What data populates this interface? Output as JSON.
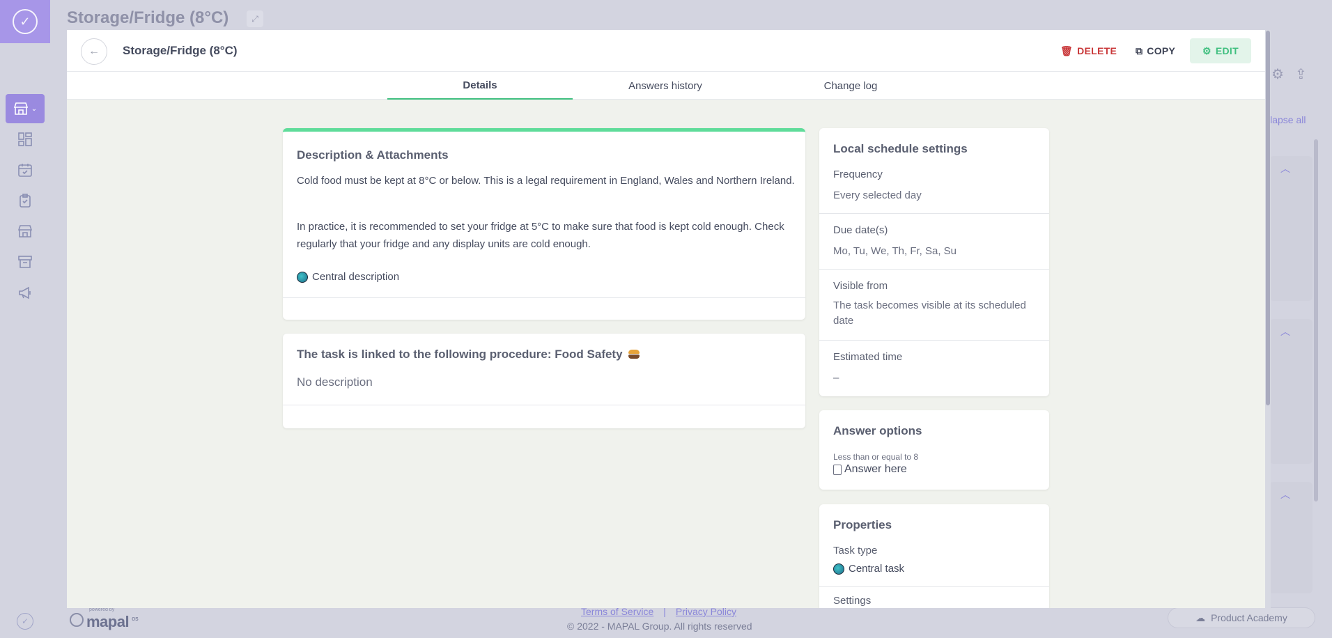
{
  "background": {
    "page_title": "Storage/Fridge (8°C)",
    "collapse_label": "llapse all"
  },
  "modal": {
    "title": "Storage/Fridge (8°C)",
    "actions": {
      "delete": "DELETE",
      "copy": "COPY",
      "edit": "EDIT"
    },
    "tabs": [
      {
        "label": "Details",
        "active": true
      },
      {
        "label": "Answers history",
        "active": false
      },
      {
        "label": "Change log",
        "active": false
      }
    ]
  },
  "description_card": {
    "heading": "Description & Attachments",
    "paragraph1": "Cold food must be kept at 8°C or below. This is a legal requirement in England, Wales and Northern Ireland.",
    "paragraph2": "In practice, it is recommended to set your fridge at 5°C to make sure that food is kept cold enough. Check regularly that your fridge and any display units are cold enough.",
    "central_label": "Central description"
  },
  "procedure_card": {
    "heading": "The task is linked to the following procedure: Food Safety",
    "no_description": "No description"
  },
  "schedule_card": {
    "heading": "Local schedule settings",
    "frequency_label": "Frequency",
    "frequency_value": "Every selected day",
    "due_label": "Due date(s)",
    "due_value": "Mo, Tu, We, Th, Fr, Sa, Su",
    "visible_label": "Visible from",
    "visible_value": "The task becomes visible at its scheduled date",
    "estimated_label": "Estimated time",
    "estimated_value": "–"
  },
  "answer_card": {
    "heading": "Answer options",
    "condition": "Less than or equal to 8",
    "answer_here": "Answer here"
  },
  "properties_card": {
    "heading": "Properties",
    "task_type_label": "Task type",
    "task_type_value": "Central task",
    "settings_label": "Settings"
  },
  "footer": {
    "powered_by": "powered by",
    "brand": "mapal",
    "brand_suffix": "os",
    "terms": "Terms of Service",
    "separator": "|",
    "privacy": "Privacy Policy",
    "copyright": "© 2022 - MAPAL Group. All rights reserved",
    "academy": "Product Academy"
  },
  "colors": {
    "accent_green": "#3fbf7f",
    "delete_red": "#c9383a",
    "rail_purple": "#a796e8"
  }
}
